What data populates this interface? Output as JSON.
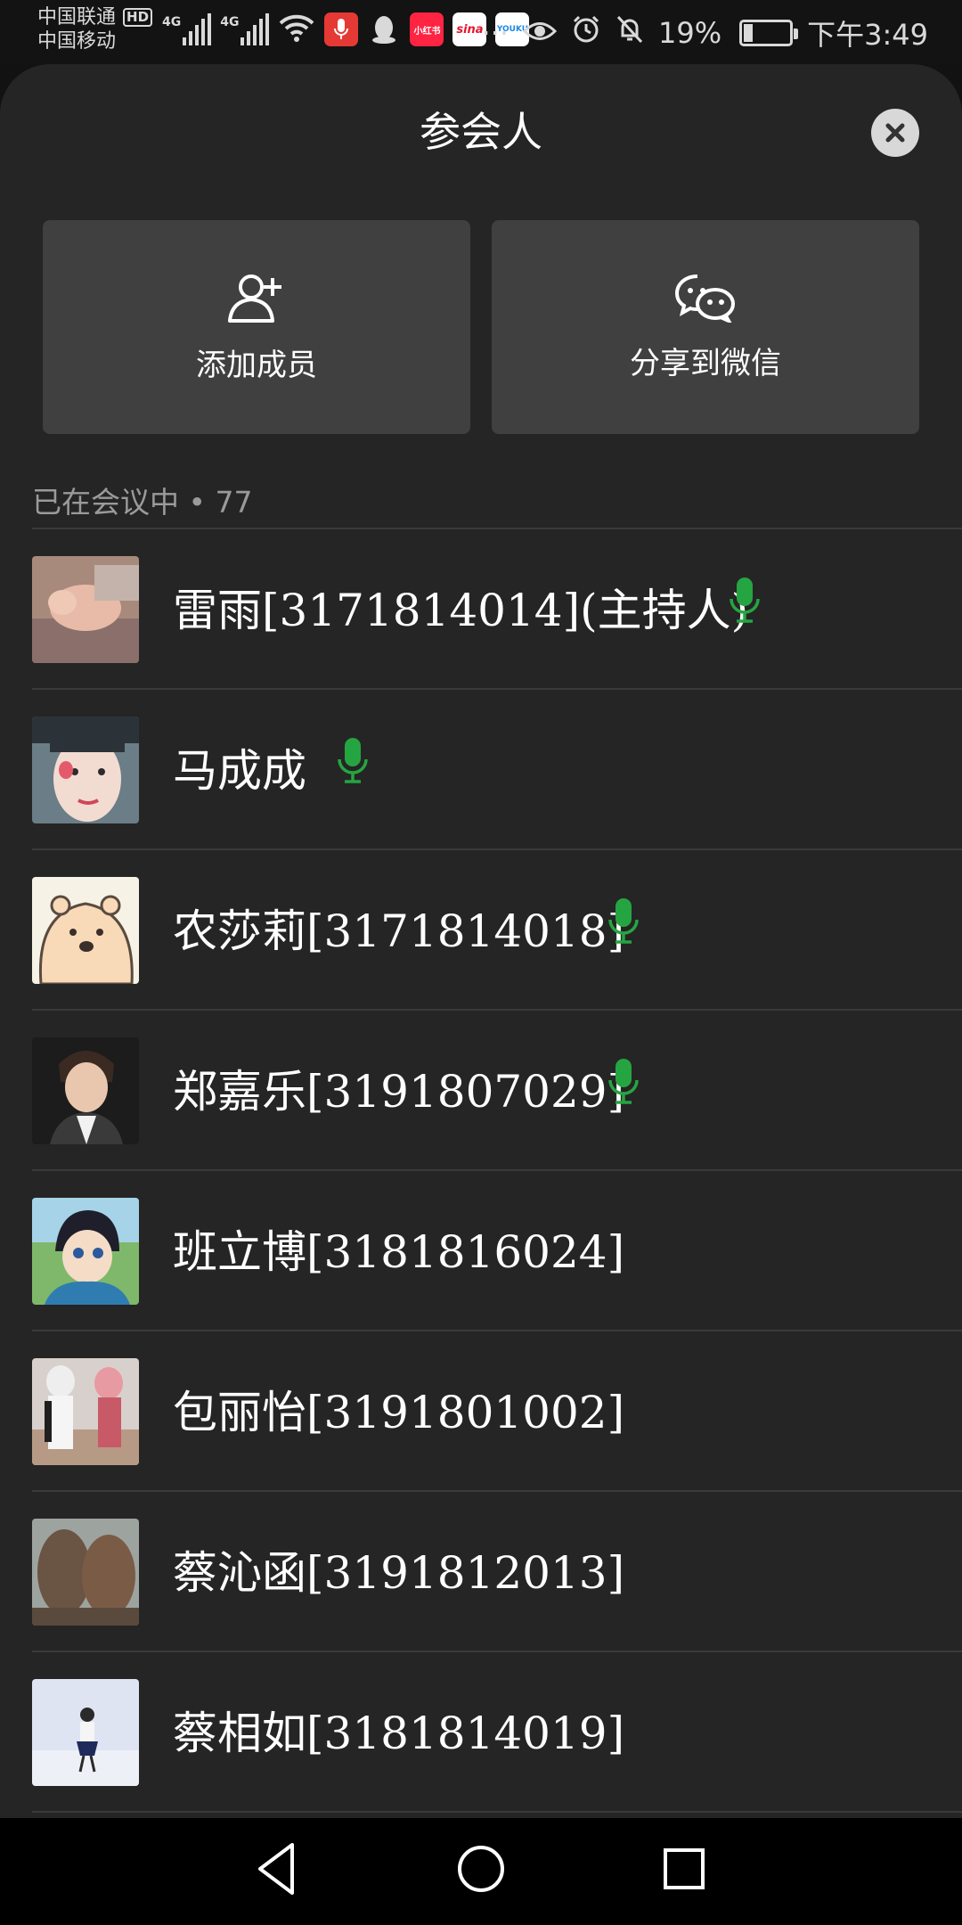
{
  "status_bar": {
    "carrier1": "中国联通",
    "carrier1_badge": "HD",
    "carrier2": "中国移动",
    "network1": "4G",
    "network2": "4G",
    "app_badge_xiaohongshu": "小红书",
    "app_badge_sina": "sina",
    "app_badge_youku": "YOUKU",
    "more": "···",
    "battery": "19%",
    "time": "下午3:49"
  },
  "sheet": {
    "title": "参会人",
    "actions": {
      "add_member": "添加成员",
      "share_wechat": "分享到微信"
    },
    "section_label": "已在会议中 • 77"
  },
  "participants": [
    {
      "name": "雷雨[3171814014](主持人)",
      "mic": true
    },
    {
      "name": "马成成",
      "mic": true
    },
    {
      "name": "农莎莉[3171814018]",
      "mic": true
    },
    {
      "name": "郑嘉乐[3191807029]",
      "mic": true
    },
    {
      "name": "班立博[3181816024]",
      "mic": false
    },
    {
      "name": "包丽怡[3191801002]",
      "mic": false
    },
    {
      "name": "蔡沁函[3191812013]",
      "mic": false
    },
    {
      "name": "蔡相如[3181814019]",
      "mic": false
    }
  ],
  "colors": {
    "mic_active": "#25a541",
    "sheet_bg": "#252525",
    "card_bg": "#404040"
  }
}
